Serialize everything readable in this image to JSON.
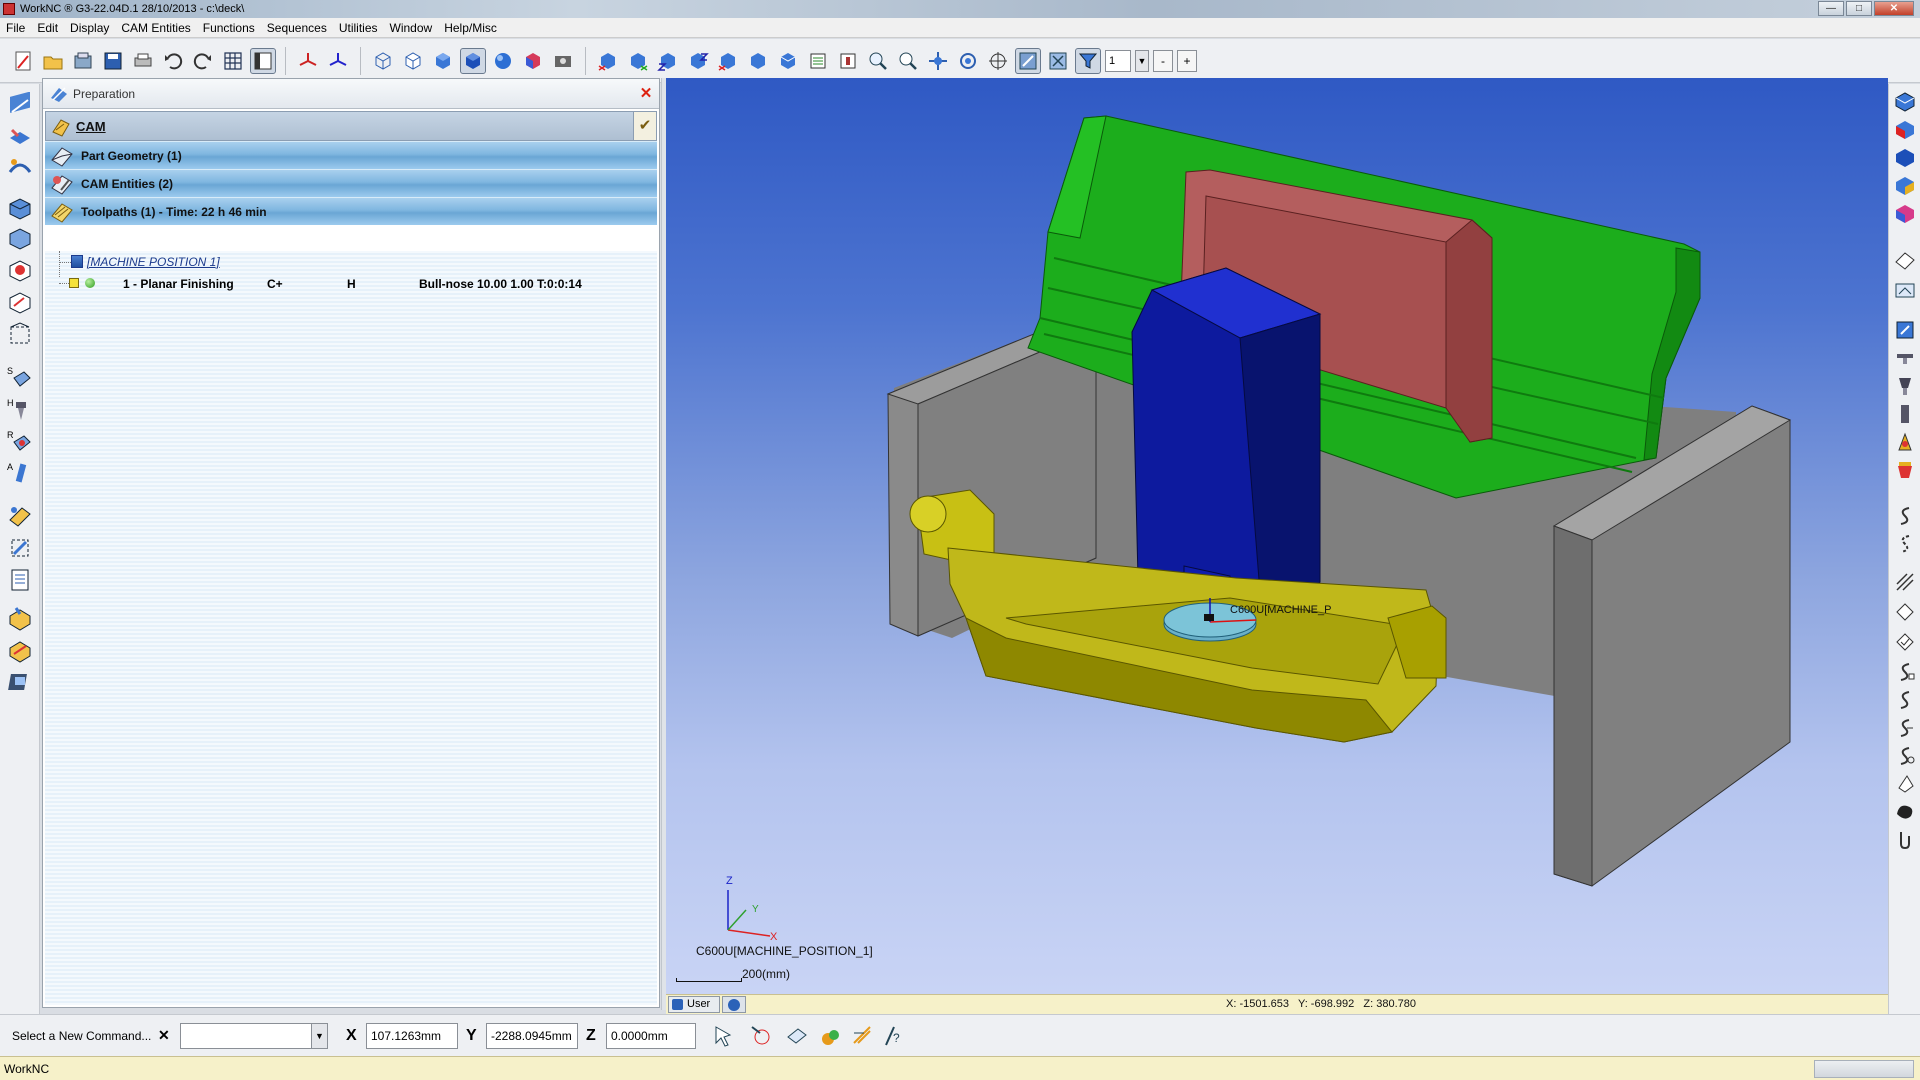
{
  "window": {
    "title": "WorkNC ® G3-22.04D.1   28/10/2013 - c:\\deck\\",
    "buttons": {
      "minimize": "—",
      "maximize": "□",
      "close": "✕"
    }
  },
  "menubar": {
    "items": [
      "File",
      "Edit",
      "Display",
      "CAM Entities",
      "Functions",
      "Sequences",
      "Utilities",
      "Window",
      "Help/Misc"
    ]
  },
  "toolbar": {
    "layer_value": "1",
    "minus_label": "-",
    "plus_label": "+",
    "icons": [
      "new-icon",
      "open-icon",
      "import-icon",
      "save-icon",
      "print-icon",
      "undo-icon",
      "redo-icon",
      "grid-icon",
      "layout-icon",
      "axis-icon",
      "axis2-icon",
      "wireframe-cube-icon",
      "hidden-cube-icon",
      "shaded-cube-icon",
      "shaded-active-icon",
      "sphere-icon",
      "render-icon",
      "camera-icon",
      "view-xy-icon",
      "view-yx-icon",
      "view-xz-icon",
      "view-zx-icon",
      "view-yz-icon",
      "view-zy-icon",
      "view-iso-icon",
      "view-list-icon",
      "view-fit-icon",
      "zoom-window-icon",
      "zoom-icon",
      "pan-icon",
      "rotate-icon",
      "center-icon",
      "select-icon",
      "select-mode-icon",
      "filter-icon"
    ]
  },
  "panel": {
    "title": "Preparation",
    "close_label": "✕",
    "cam_label": "CAM",
    "check_label": "✔",
    "sections": [
      {
        "label": "Part Geometry (1)"
      },
      {
        "label": "CAM Entities (2)"
      },
      {
        "label": "Toolpaths (1) - Time: 22 h 46 min"
      }
    ],
    "tree": {
      "machine_position": "[MACHINE POSITION 1]",
      "toolpath": {
        "name": "1 - Planar Finishing",
        "col1": "C+",
        "col2": "H",
        "tool": "Bull-nose 10.00 1.00 T:0:0:14"
      }
    }
  },
  "viewport": {
    "machine_label": "C600U[MACHINE_P",
    "axis_label": "C600U[MACHINE_POSITION_1]",
    "scale_label": "200(mm)",
    "axis_x": "X",
    "axis_y": "Y",
    "axis_z": "Z",
    "tab_user": "User",
    "coords": "X: -1501.653   Y: -698.992   Z: 380.780"
  },
  "command_bar": {
    "label": "Select a New Command...",
    "clear_label": "✕",
    "combo_value": "",
    "x_label": "X",
    "x_value": "107.1263mm",
    "y_label": "Y",
    "y_value": "-2288.0945mm",
    "z_label": "Z",
    "z_value": "0.0000mm"
  },
  "status_bar": {
    "text": "WorkNC"
  },
  "colors": {
    "viewport_top": "#2f59c4",
    "viewport_bottom": "#c9d4f5",
    "section_blue": "#7fb6e0",
    "status_yellow": "#f6f1c9",
    "part_green": "#1fb21f",
    "fixture_gray": "#808080",
    "spindle_blue": "#0e1aa8",
    "slide_red": "#b05555",
    "table_yellow": "#b8b010"
  }
}
